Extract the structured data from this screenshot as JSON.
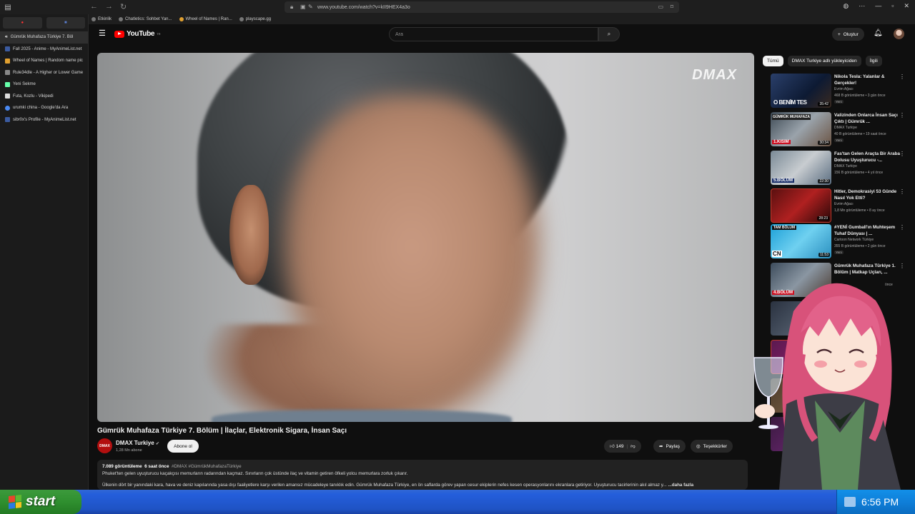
{
  "browser": {
    "url": "www.youtube.com/watch?v=kII9HEX4a3o",
    "bookmarks": [
      "Etkinlik",
      "Chatletics: Sohbet Yan...",
      "Wheel of Names | Ran...",
      "playscape.gg"
    ],
    "tabs": [
      {
        "label": "Gümrük Muhafaza Türkiye 7. Böl",
        "active": true
      },
      {
        "label": "Fall 2025 - Anime - MyAnimeList.net"
      },
      {
        "label": "Wheel of Names | Random name pic"
      },
      {
        "label": "Rule34dle - A Higher or Lower Game"
      },
      {
        "label": "Yeni Sekme"
      },
      {
        "label": "Futa, Kozlu - Vikipedi"
      },
      {
        "label": "urumki china - Google'da Ara"
      },
      {
        "label": "sibr0x's Profile - MyAnimeList.net"
      }
    ]
  },
  "header": {
    "logo": "YouTube",
    "logo_sup": "TR",
    "search_placeholder": "Ara",
    "create_label": "Oluştur"
  },
  "video": {
    "watermark": "DMAX",
    "title": "Gümrük Muhafaza Türkiye 7. Bölüm | İlaçlar, Elektronik Sigara, İnsan Saçı",
    "channel": "DMAX Turkiye",
    "subs": "1,28 Mn abone",
    "subscribe_label": "Abone ol",
    "likes": "149",
    "share_label": "Paylaş",
    "thanks_label": "Teşekkürler",
    "views": "7.089 görüntüleme",
    "age": "6 saat önce",
    "hashtags": "#DMAX #GümrükMuhafazaTürkiye",
    "desc1": "Phuket'ten gelen uyuşturucu kaçakçısı memurların radarından kaçmaz. Sınırların çok üstünde ilaç ve vitamin getiren öfkeli yolcu memurlara zorluk çıkarır.",
    "desc2": "Ülkenin dört bir yanındaki kara, hava ve deniz kapılarında yasa dışı faaliyetlere karşı verilen amansız mücadeleye tanıklık edin. Gümrük Muhafaza Türkiye, en ön saflarda görev yapan cesur ekiplerin nefes kesen operasyonlarını ekranlara getiriyor. Uyuşturucu tacirlerinin akıl almaz y...",
    "more_label": "...daha fazla"
  },
  "chips": [
    "Tümü",
    "DMAX Turkiye adlı yükleyiciden",
    "İlgili"
  ],
  "recommendations": [
    {
      "title": "Nikola Tesla: Yalanlar & Gerçekler!",
      "channel": "Evrim Ağacı",
      "meta": "468 B görüntüleme • 3 gün önce",
      "badge": "Yeni",
      "duration": "35:42",
      "thumb_text": "O BENİM TES"
    },
    {
      "title": "Valizinden Onlarca İnsan Saçı Çıktı | Gümrük ...",
      "channel": "DMAX Turkiye",
      "meta": "40 B görüntüleme • 19 saat önce",
      "badge": "Yeni",
      "duration": "30:34",
      "thumb_text": "1.KISIM"
    },
    {
      "title": "Fas'tan Gelen Araçta Bir Araba Dolusu Uyuşturucu -...",
      "channel": "DMAX Turkiye",
      "meta": "156 B görüntüleme • 4 yıl önce",
      "badge": "",
      "duration": "22:30",
      "thumb_text": "5.BÖLÜM"
    },
    {
      "title": "Hitler, Demokrasiyi 53 Günde Nasıl Yok Etti?",
      "channel": "Evrim Ağacı",
      "meta": "1,8 Mn görüntüleme • 8 ay önce",
      "badge": "",
      "duration": "28:23",
      "thumb_text": ""
    },
    {
      "title": "#YENİ Gumball'ın Muhteşem Tuhaf Dünyası | ...",
      "channel": "Cartoon Network Türkiye",
      "meta": "355 B görüntüleme • 2 gün önce",
      "badge": "Yeni",
      "duration": "11:53",
      "thumb_text": "TAM BÖLÜM"
    },
    {
      "title": "Gümrük Muhafaza Türkiye 1. Bölüm | Matkap Uçları, ...",
      "channel": "DMAX Turkiye",
      "meta": "önce",
      "badge": "",
      "duration": "",
      "thumb_text": "4.BÖLÜM"
    }
  ],
  "taskbar": {
    "start_label": "start",
    "clock": "6:56 PM"
  },
  "colors": {
    "yt_red": "#ff0000",
    "taskbar_blue": "#245edb",
    "start_green": "#2f8f2f"
  }
}
